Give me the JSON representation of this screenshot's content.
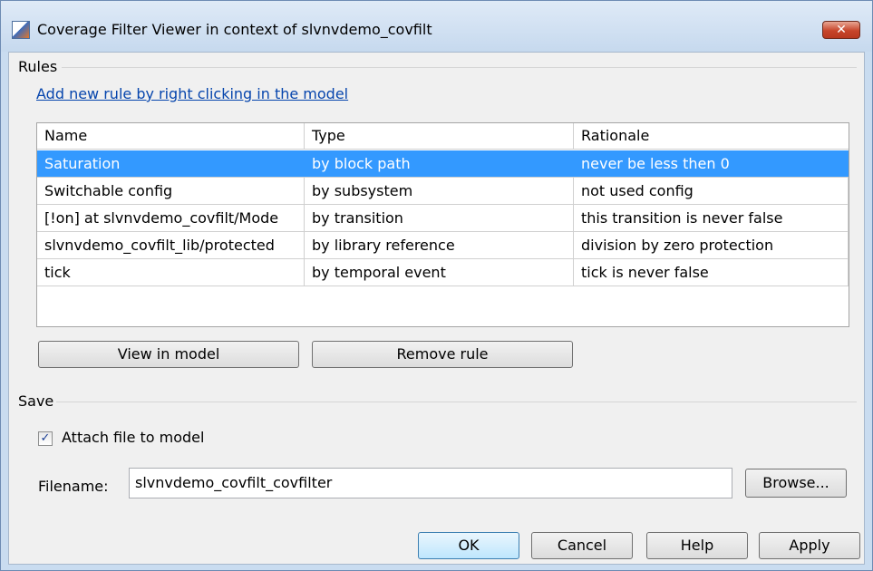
{
  "window": {
    "title": "Coverage Filter Viewer in context of slvnvdemo_covfilt",
    "close_glyph": "✕"
  },
  "rules": {
    "group_label": "Rules",
    "add_rule_link": "Add new rule by right clicking in the model",
    "columns": [
      "Name",
      "Type",
      "Rationale"
    ],
    "rows": [
      {
        "name": "Saturation",
        "type": "by block path",
        "rationale": "never be less then 0",
        "selected": true
      },
      {
        "name": "Switchable config",
        "type": "by subsystem",
        "rationale": "not used config",
        "selected": false
      },
      {
        "name": "[!on] at slvnvdemo_covfilt/Mode",
        "type": "by transition",
        "rationale": "this transition is never false",
        "selected": false
      },
      {
        "name": "slvnvdemo_covfilt_lib/protected",
        "type": "by library reference",
        "rationale": "division by zero protection",
        "selected": false
      },
      {
        "name": "tick",
        "type": "by temporal event",
        "rationale": "tick is never false",
        "selected": false
      }
    ],
    "view_in_model_label": "View in model",
    "remove_rule_label": "Remove rule"
  },
  "save": {
    "group_label": "Save",
    "attach_checked": true,
    "attach_label": "Attach file to model",
    "check_glyph": "✓",
    "filename_label": "Filename:",
    "filename_value": "slvnvdemo_covfilt_covfilter",
    "browse_label": "Browse..."
  },
  "footer": {
    "ok_label": "OK",
    "cancel_label": "Cancel",
    "help_label": "Help",
    "apply_label": "Apply"
  },
  "colors": {
    "selection": "#3399ff",
    "link": "#0645ad",
    "close_button": "#c7452a"
  }
}
